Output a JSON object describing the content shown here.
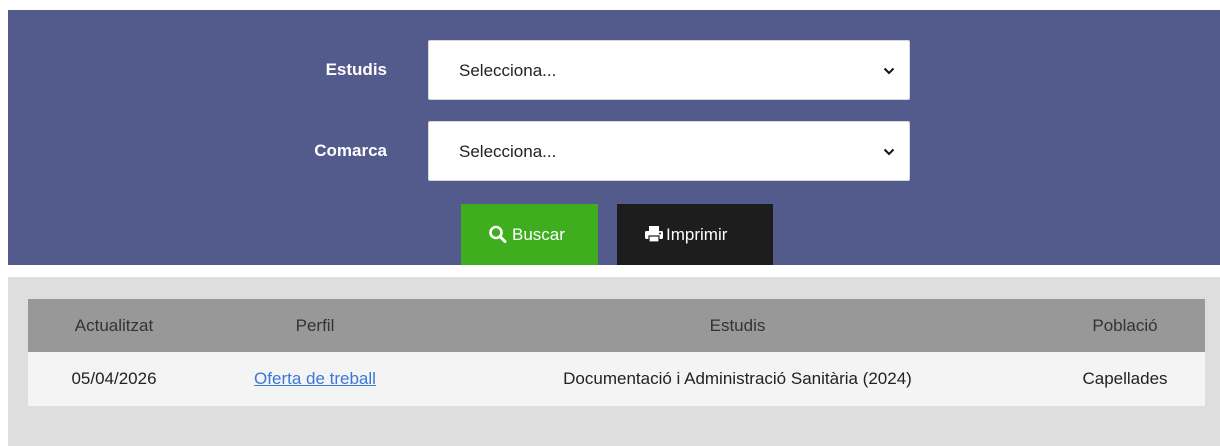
{
  "filters": {
    "studies": {
      "label": "Estudis",
      "value": "Selecciona..."
    },
    "region": {
      "label": "Comarca",
      "value": "Selecciona..."
    }
  },
  "buttons": {
    "search": {
      "label": "Buscar",
      "icon": "search-icon",
      "color": "#3fae1e"
    },
    "print": {
      "label": "Imprimir",
      "icon": "print-icon",
      "color": "#1d1d1d"
    }
  },
  "colors": {
    "panel_bg": "#535a8c",
    "results_bg": "#dedede",
    "header_bg": "#989898",
    "link": "#3a78d8"
  },
  "table": {
    "headers": [
      "Actualitzat",
      "Perfil",
      "Estudis",
      "Població"
    ],
    "rows": [
      {
        "updated": "05/04/2026",
        "profile": "Oferta de treball",
        "studies": "Documentació i Administració Sanitària (2024)",
        "town": "Capellades"
      }
    ]
  }
}
